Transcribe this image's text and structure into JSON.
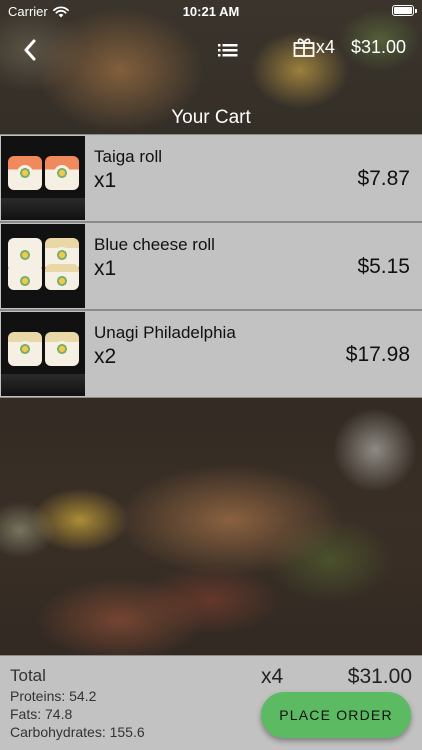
{
  "status_bar": {
    "carrier": "Carrier",
    "time": "10:21 AM",
    "icons": [
      "wifi-icon",
      "battery-icon"
    ]
  },
  "nav": {
    "back_icon": "chevron-left-icon",
    "list_icon": "list-icon",
    "cart_icon": "gift-icon",
    "cart_count": "x4",
    "cart_total": "$31.00"
  },
  "page_title": "Your Cart",
  "cart_items": [
    {
      "name": "Taiga roll",
      "qty": "x1",
      "price": "$7.87"
    },
    {
      "name": "Blue cheese roll",
      "qty": "x1",
      "price": "$5.15"
    },
    {
      "name": "Unagi Philadelphia",
      "qty": "x2",
      "price": "$17.98"
    }
  ],
  "footer": {
    "total_label": "Total",
    "proteins": "Proteins: 54.2",
    "fats": "Fats: 74.8",
    "carbohydrates": "Carbohydrates: 155.6",
    "total_count": "x4",
    "total_price": "$31.00",
    "place_order_label": "PLACE ORDER"
  },
  "colors": {
    "item_background": "#c2c2c2",
    "place_order": "#5cba62",
    "text_on_background": "#ffffff"
  }
}
